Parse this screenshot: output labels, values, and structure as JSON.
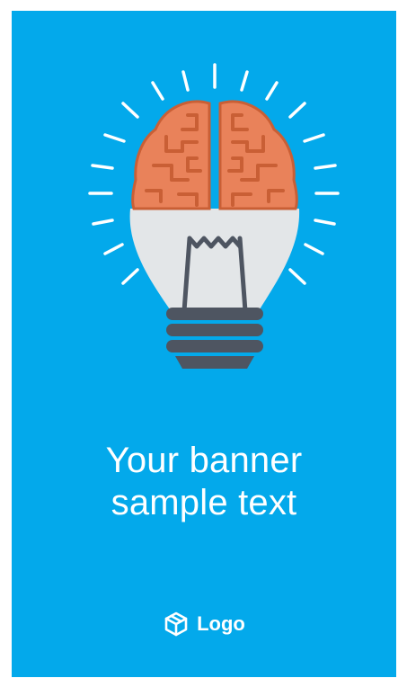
{
  "banner": {
    "headline_line1": "Your banner",
    "headline_line2": "sample text",
    "logo_text": "Logo"
  },
  "colors": {
    "background": "#03A9EB",
    "brain": "#E9825A",
    "brain_outline": "#C95F35",
    "bulb_glass": "#E3E6E8",
    "bulb_base": "#4E5561",
    "text": "#FFFFFF"
  },
  "icons": [
    "lightbulb-brain-icon",
    "light-ray-icon",
    "cube-logo-icon"
  ]
}
